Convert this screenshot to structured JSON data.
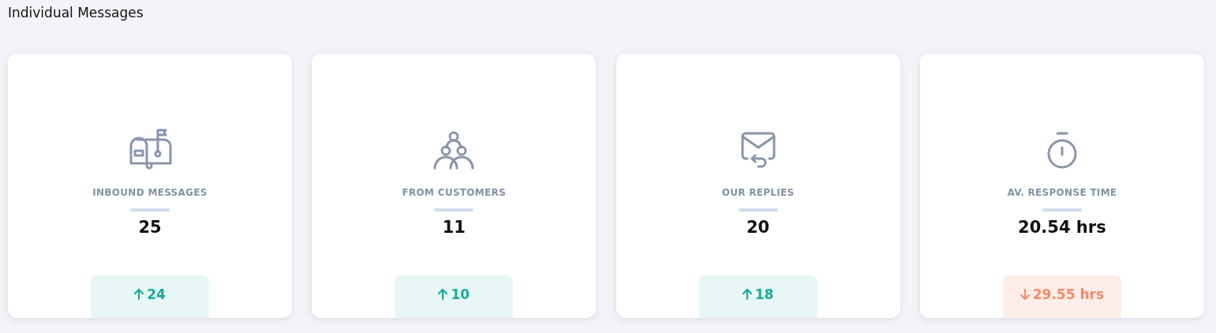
{
  "section": {
    "title": "Individual Messages"
  },
  "cards": [
    {
      "kind": "mailbox",
      "label": "INBOUND MESSAGES",
      "value": "25",
      "rising": true,
      "change": "24"
    },
    {
      "kind": "people",
      "label": "FROM CUSTOMERS",
      "value": "11",
      "rising": true,
      "change": "10"
    },
    {
      "kind": "reply",
      "label": "OUR REPLIES",
      "value": "20",
      "rising": true,
      "change": "18"
    },
    {
      "kind": "stopwatch",
      "label": "AV. RESPONSE TIME",
      "value": "20.54 hrs",
      "rising": false,
      "change": "29.55 hrs"
    }
  ]
}
